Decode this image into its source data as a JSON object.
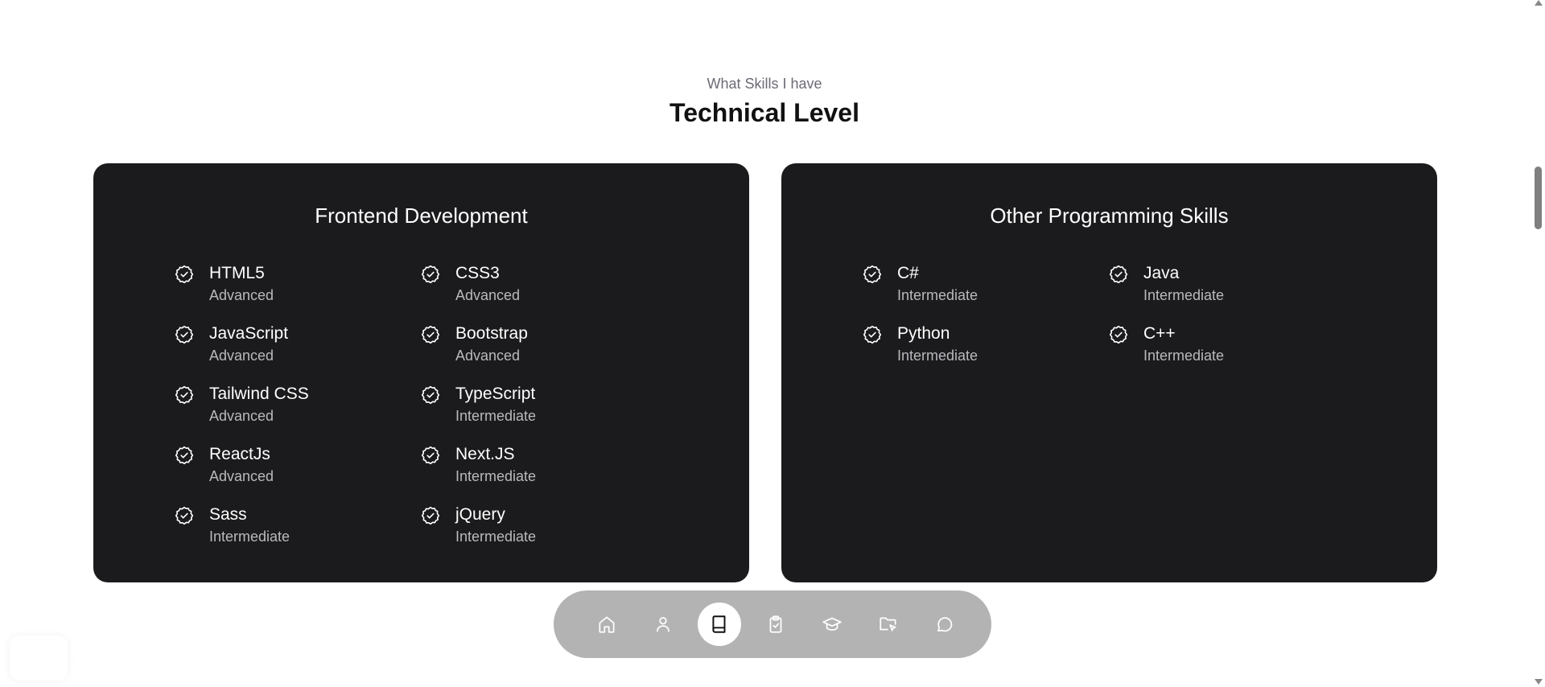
{
  "section": {
    "subtitle": "What Skills I have",
    "title": "Technical Level"
  },
  "cards": [
    {
      "title": "Frontend Development",
      "skills": [
        {
          "name": "HTML5",
          "level": "Advanced"
        },
        {
          "name": "CSS3",
          "level": "Advanced"
        },
        {
          "name": "JavaScript",
          "level": "Advanced"
        },
        {
          "name": "Bootstrap",
          "level": "Advanced"
        },
        {
          "name": "Tailwind CSS",
          "level": "Advanced"
        },
        {
          "name": "TypeScript",
          "level": "Intermediate"
        },
        {
          "name": "ReactJs",
          "level": "Advanced"
        },
        {
          "name": "Next.JS",
          "level": "Intermediate"
        },
        {
          "name": "Sass",
          "level": "Intermediate"
        },
        {
          "name": "jQuery",
          "level": "Intermediate"
        }
      ]
    },
    {
      "title": "Other Programming Skills",
      "skills": [
        {
          "name": "C#",
          "level": "Intermediate"
        },
        {
          "name": "Java",
          "level": "Intermediate"
        },
        {
          "name": "Python",
          "level": "Intermediate"
        },
        {
          "name": "C++",
          "level": "Intermediate"
        }
      ]
    }
  ],
  "dock": {
    "items": [
      {
        "icon": "home-icon",
        "active": false
      },
      {
        "icon": "user-icon",
        "active": false
      },
      {
        "icon": "book-icon",
        "active": true
      },
      {
        "icon": "clipboard-check-icon",
        "active": false
      },
      {
        "icon": "graduation-cap-icon",
        "active": false
      },
      {
        "icon": "folder-cursor-icon",
        "active": false
      },
      {
        "icon": "chat-bubble-icon",
        "active": false
      }
    ]
  },
  "colors": {
    "card_bg": "#1b1b1d",
    "dock_bg": "#b3b3b3",
    "title": "#111111",
    "subtitle": "#6b6b75",
    "skill_level": "#b9b9be"
  }
}
